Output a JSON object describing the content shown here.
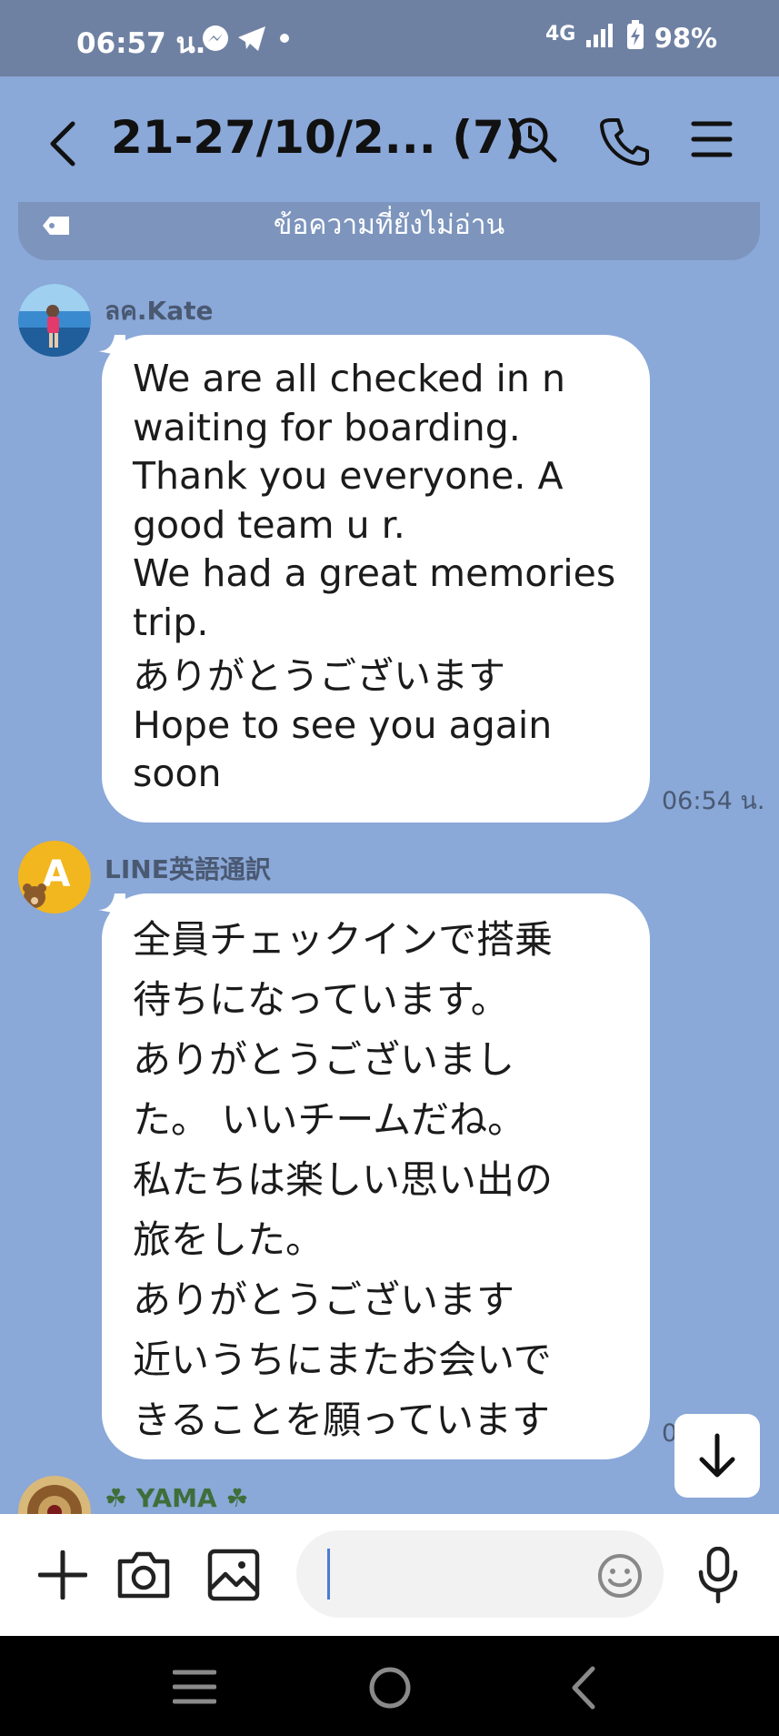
{
  "status_bar": {
    "time": "06:57 น.",
    "network": "4G",
    "battery": "98%"
  },
  "header": {
    "title": "21-27/10/2...  (7)"
  },
  "unread_banner": {
    "label": "ข้อความที่ยังไม่อ่าน"
  },
  "messages": [
    {
      "sender": "ลค.Kate",
      "lines": [
        "We are all checked in n",
        "waiting for boarding.",
        "Thank you everyone. A",
        "good team u r.",
        "We had a great memories",
        "trip.",
        "ありがとうございます",
        "Hope to see you again",
        "soon"
      ],
      "time": "06:54 น."
    },
    {
      "sender": "LINE英語通訳",
      "avatar_letter": "A",
      "lines": [
        "全員チェックインで搭乗",
        "待ちになっています。",
        "ありがとうございまし",
        "た。 いいチームだね。",
        "私たちは楽しい思い出の",
        "旅をした。",
        "ありがとうございます",
        "近いうちにまたお会いで",
        "きることを願っています"
      ],
      "time_partial": "0"
    },
    {
      "sender": "☘ YAMA ☘"
    }
  ],
  "input": {
    "placeholder": ""
  },
  "colors": {
    "chat_background": "#8aa8d8",
    "status_bar": "#6f81a3",
    "bubble": "#ffffff",
    "nav_bar": "#000000"
  }
}
